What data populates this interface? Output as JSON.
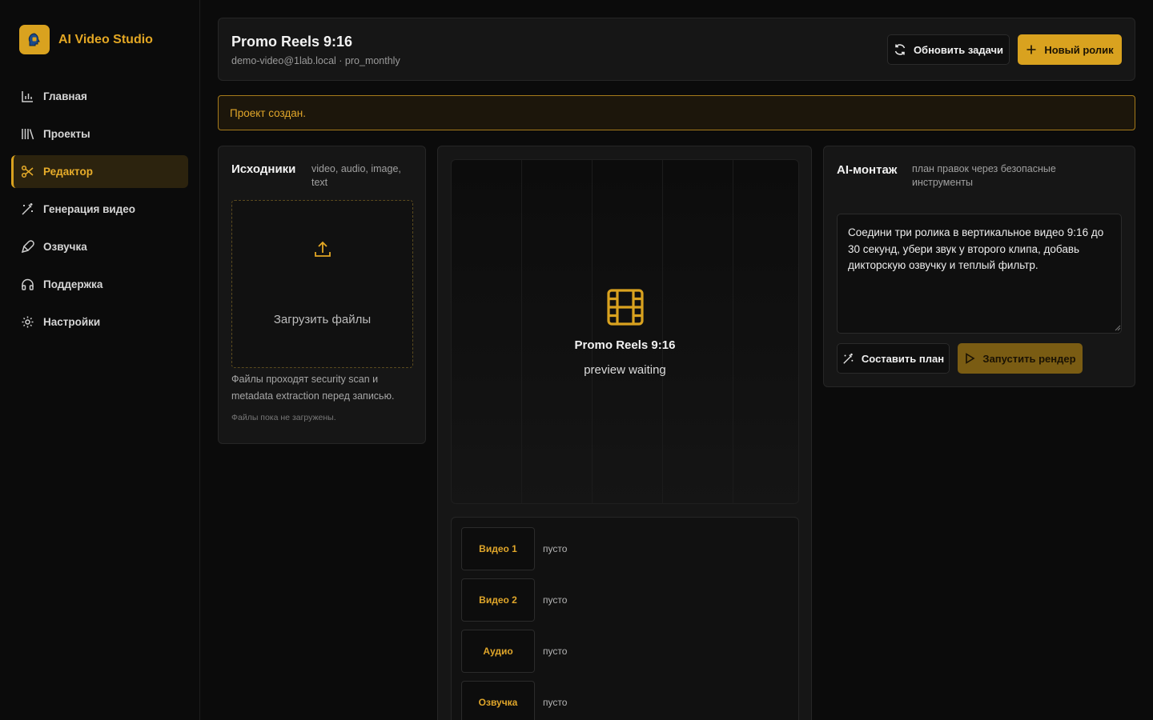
{
  "app": {
    "name": "AI Video Studio",
    "accent": "#d9a21f"
  },
  "sidebar": {
    "items": [
      {
        "label": "Главная",
        "icon": "bar-chart-icon"
      },
      {
        "label": "Проекты",
        "icon": "library-icon"
      },
      {
        "label": "Редактор",
        "icon": "scissors-icon",
        "active": true
      },
      {
        "label": "Генерация видео",
        "icon": "magic-wand-icon"
      },
      {
        "label": "Озвучка",
        "icon": "microphone-icon"
      },
      {
        "label": "Поддержка",
        "icon": "headphones-icon"
      },
      {
        "label": "Настройки",
        "icon": "gear-icon"
      }
    ]
  },
  "header": {
    "title": "Promo Reels 9:16",
    "subtitle": "demo-video@1lab.local · pro_monthly",
    "refresh_label": "Обновить задачи",
    "new_label": "Новый ролик"
  },
  "alert": {
    "text": "Проект создан."
  },
  "sources": {
    "title": "Исходники",
    "hint": "video, audio, image, text",
    "upload_label": "Загрузить файлы",
    "note": "Файлы проходят security scan и metadata extraction перед записью.",
    "empty": "Файлы пока не загружены."
  },
  "preview": {
    "title": "Promo Reels 9:16",
    "status": "preview waiting"
  },
  "timeline": {
    "tracks": [
      {
        "label": "Видео 1",
        "state": "пусто"
      },
      {
        "label": "Видео 2",
        "state": "пусто"
      },
      {
        "label": "Аудио",
        "state": "пусто"
      },
      {
        "label": "Озвучка",
        "state": "пусто"
      }
    ]
  },
  "ai": {
    "title": "AI-монтаж",
    "hint": "план правок через безопасные инструменты",
    "prompt": "Соедини три ролика в вертикальное видео 9:16 до 30 секунд, убери звук у второго клипа, добавь дикторскую озвучку и теплый фильтр.",
    "plan_label": "Составить план",
    "render_label": "Запустить рендер"
  }
}
